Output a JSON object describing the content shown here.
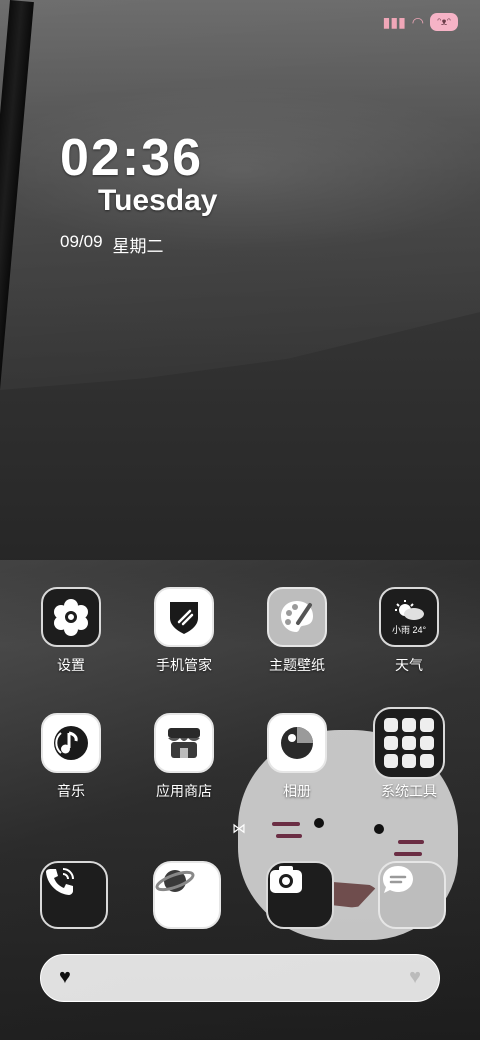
{
  "status_bar": {
    "signal_icon": "signal-icon",
    "wifi_icon": "wifi-icon",
    "battery_icon": "battery-icon",
    "accent": "#f4a9bd"
  },
  "lockclock": {
    "time": "02:36",
    "weekday": "Tuesday",
    "date": "09/09",
    "lunar_weekday": "星期二"
  },
  "apps": [
    {
      "label": "设置",
      "icon": "settings-flower-icon"
    },
    {
      "label": "手机管家",
      "icon": "shield-icon"
    },
    {
      "label": "主题壁纸",
      "icon": "palette-icon"
    },
    {
      "label": "天气",
      "icon": "weather-sun-cloud-icon",
      "badge_text": "小雨 24°"
    },
    {
      "label": "音乐",
      "icon": "music-note-icon"
    },
    {
      "label": "应用商店",
      "icon": "store-icon"
    },
    {
      "label": "相册",
      "icon": "gallery-icon"
    },
    {
      "label": "系统工具",
      "icon": "folder-icon"
    }
  ],
  "dock": [
    {
      "name": "phone",
      "icon": "phone-icon"
    },
    {
      "name": "browser",
      "icon": "planet-icon"
    },
    {
      "name": "camera",
      "icon": "camera-icon"
    },
    {
      "name": "messages",
      "icon": "message-bubble-icon"
    }
  ],
  "search_bar": {
    "left_icon": "heart-icon",
    "right_icon": "heart-icon"
  }
}
